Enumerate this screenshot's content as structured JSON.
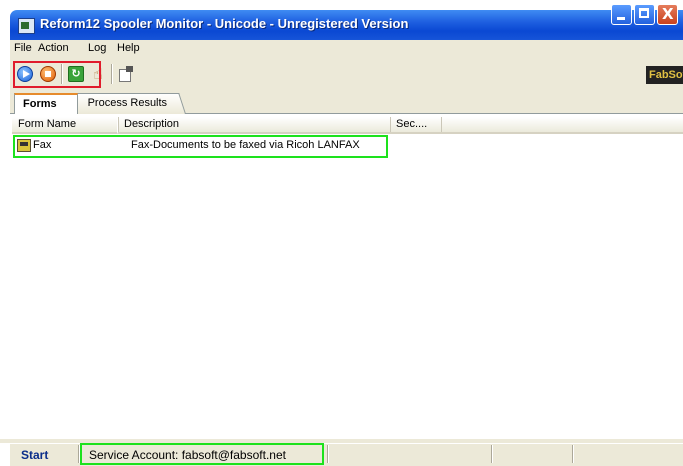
{
  "window": {
    "title": "Reform12 Spooler Monitor - Unicode - Unregistered Version",
    "min_icon": "minimize-icon",
    "max_icon": "maximize-icon",
    "close_label": "X"
  },
  "menu": {
    "items": [
      {
        "label": "File"
      },
      {
        "label": "Action"
      },
      {
        "label": "Log"
      },
      {
        "label": "Help"
      }
    ]
  },
  "toolbar": {
    "buttons": [
      "start-icon",
      "stop-icon",
      "refresh-icon",
      "hand-icon",
      "properties-icon"
    ],
    "refresh_glyph": "↻",
    "hand_glyph": "☝",
    "logo_text": "FabSoft"
  },
  "tabs": [
    {
      "label": "Forms",
      "active": true
    },
    {
      "label": "Process Results",
      "active": false
    }
  ],
  "list": {
    "columns": [
      "Form Name",
      "Description",
      "Sec...."
    ],
    "rows": [
      {
        "name": "Fax",
        "description": "Fax-Documents to be faxed via Ricoh LANFAX"
      }
    ]
  },
  "status": {
    "state": "Start",
    "account": "Service Account:   fabsoft@fabsoft.net"
  },
  "colors": {
    "title_bar": "#1e5fe0",
    "highlight_red": "#e01c2c",
    "highlight_green": "#1de21d"
  }
}
